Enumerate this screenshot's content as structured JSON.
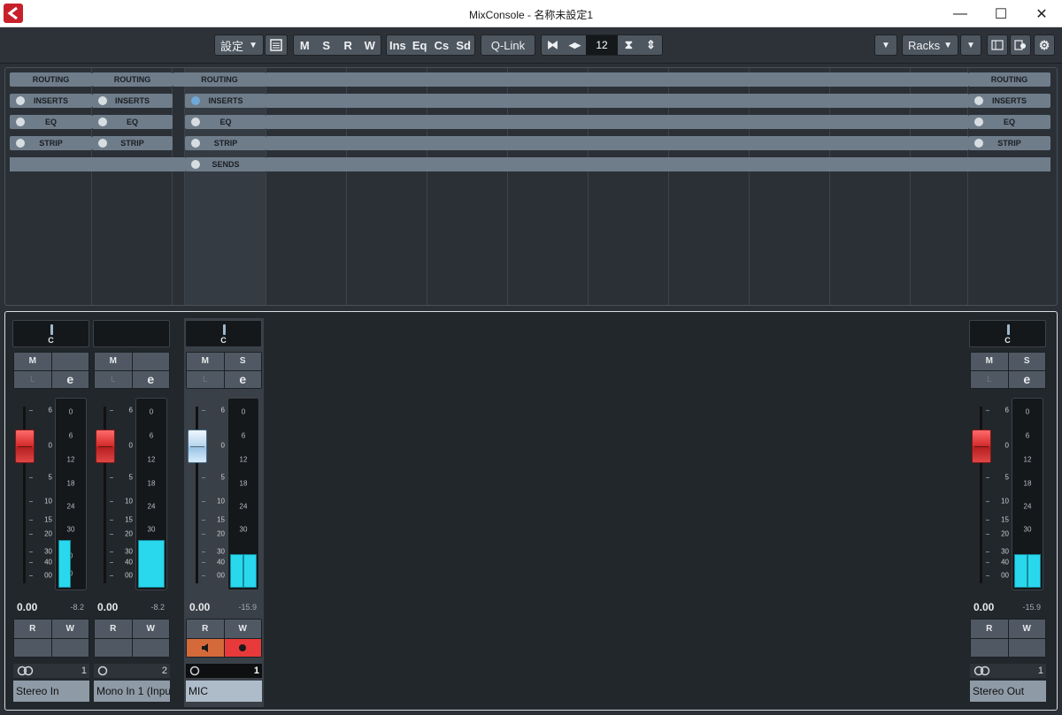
{
  "window": {
    "title": "MixConsole - 名称未設定1",
    "minimize": "—",
    "maximize": "☐",
    "close": "✕"
  },
  "toolbar": {
    "settings_label": "設定",
    "m": "M",
    "s": "S",
    "r": "R",
    "w": "W",
    "ins": "Ins",
    "eq": "Eq",
    "cs": "Cs",
    "sd": "Sd",
    "qlink": "Q-Link",
    "channel_count": "12",
    "racks": "Racks"
  },
  "racks": {
    "routing": "ROUTING",
    "inserts": "INSERTS",
    "eq": "EQ",
    "strip": "STRIP",
    "sends": "SENDS"
  },
  "channels": [
    {
      "name": "Stereo In",
      "number": "1",
      "pan": "C",
      "volume": "0.00",
      "peak": "-8.2",
      "m": "M",
      "s": "",
      "l": "L",
      "e": "e",
      "r": "R",
      "w": "W",
      "icon": "stereo-link-icon"
    },
    {
      "name": "Mono In 1 (Inpu",
      "number": "2",
      "pan": "",
      "volume": "0.00",
      "peak": "-8.2",
      "m": "M",
      "s": "",
      "l": "L",
      "e": "e",
      "r": "R",
      "w": "W",
      "icon": "mono-icon"
    },
    {
      "name": "MIC",
      "number": "1",
      "pan": "C",
      "volume": "0.00",
      "peak": "-15.9",
      "m": "M",
      "s": "S",
      "l": "L",
      "e": "e",
      "r": "R",
      "w": "W",
      "icon": "mono-icon"
    },
    {
      "name": "Stereo Out",
      "number": "1",
      "pan": "C",
      "volume": "0.00",
      "peak": "-15.9",
      "m": "M",
      "s": "S",
      "l": "L",
      "e": "e",
      "r": "R",
      "w": "W",
      "icon": "stereo-link-icon"
    }
  ],
  "fader_scale": [
    "6",
    "0",
    "5",
    "10",
    "15",
    "20",
    "30",
    "40",
    "00"
  ],
  "meter_scale": [
    "0",
    "6",
    "12",
    "18",
    "24",
    "30",
    "0",
    "0"
  ],
  "meter_scale_alt": [
    "0",
    "6",
    "12",
    "18",
    "24",
    "30",
    "36",
    "42"
  ],
  "colors": {
    "accent_cyan": "#2ad8ee",
    "fader_red": "#d73030",
    "fader_selected": "#bcd9ef",
    "monitor_orange": "#d46a3a",
    "record_red": "#e83a3a"
  }
}
